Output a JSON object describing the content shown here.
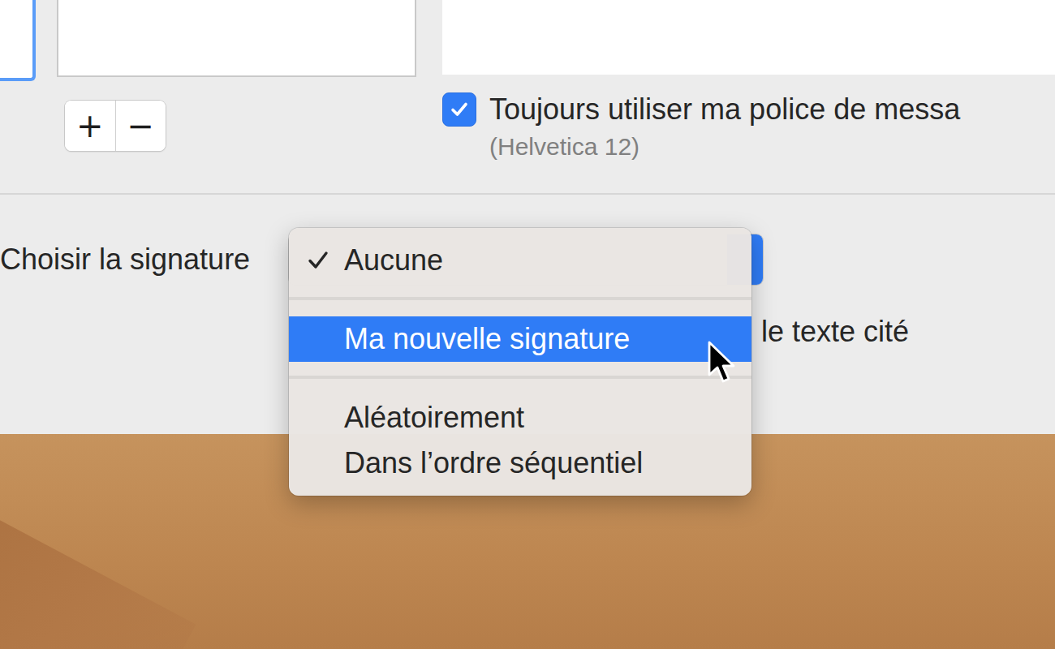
{
  "lists": {
    "buttons": [
      "+",
      "−"
    ]
  },
  "font_option": {
    "label": "Toujours utiliser ma police de messa",
    "checked": true,
    "detail": "(Helvetica 12)"
  },
  "signature_picker": {
    "label": "Choisir la signature",
    "menu_groups": [
      [
        {
          "label": "Aucune",
          "checked": true,
          "selected": false
        }
      ],
      [
        {
          "label": "Ma nouvelle signature",
          "checked": false,
          "selected": true
        }
      ],
      [
        {
          "label": "Aléatoirement",
          "checked": false,
          "selected": false
        },
        {
          "label": "Dans l’ordre séquentiel",
          "checked": false,
          "selected": false
        }
      ]
    ]
  },
  "quote_option": {
    "label": "le texte cité"
  }
}
